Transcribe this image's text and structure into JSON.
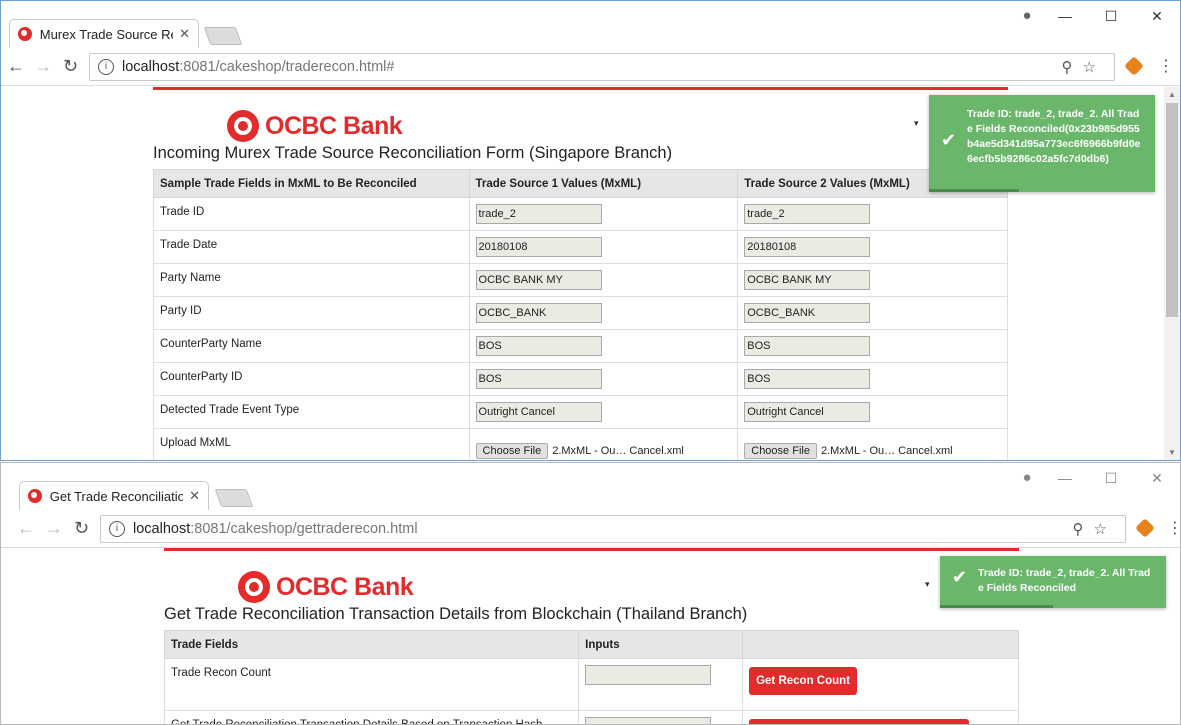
{
  "window1": {
    "tab_title": "Murex Trade Source Reconciliation",
    "tab_close": "✕",
    "address_host": "localhost",
    "address_path": ":8081/cakeshop/traderecon.html#",
    "bank_name": "OCBC Bank",
    "page_title": "Incoming Murex Trade Source Reconciliation Form (Singapore Branch)",
    "table": {
      "headers": [
        "Sample Trade Fields in MxML to Be Reconciled",
        "Trade Source 1 Values (MxML)",
        "Trade Source 2 Values (MxML)"
      ],
      "rows": [
        {
          "label": "Trade ID",
          "v1": "trade_2",
          "v2": "trade_2"
        },
        {
          "label": "Trade Date",
          "v1": "20180108",
          "v2": "20180108"
        },
        {
          "label": "Party Name",
          "v1": "OCBC BANK MY",
          "v2": "OCBC BANK MY"
        },
        {
          "label": "Party ID",
          "v1": "OCBC_BANK",
          "v2": "OCBC_BANK"
        },
        {
          "label": "CounterParty Name",
          "v1": "BOS",
          "v2": "BOS"
        },
        {
          "label": "CounterParty ID",
          "v1": "BOS",
          "v2": "BOS"
        },
        {
          "label": "Detected Trade Event Type",
          "v1": "Outright Cancel",
          "v2": "Outright Cancel"
        }
      ],
      "upload_label": "Upload MxML",
      "choose_file": "Choose File",
      "file1": "2.MxML - Ou… Cancel.xml",
      "file2": "2.MxML - Ou… Cancel.xml"
    },
    "toast": "Trade ID: trade_2, trade_2. All Trade Fields Reconciled(0x23b985d955b4ae5d341d95a773ec6f6966b9fd0e6ecfb5b9286c02a5fc7d0db6)",
    "toast_progress": 0.4
  },
  "window2": {
    "tab_title": "Get Trade Reconciliation",
    "tab_close": "✕",
    "address_host": "localhost",
    "address_path": ":8081/cakeshop/gettraderecon.html",
    "bank_name": "OCBC Bank",
    "page_title": "Get Trade Reconciliation Transaction Details from Blockchain (Thailand Branch)",
    "table": {
      "headers": [
        "Trade Fields",
        "Inputs",
        ""
      ],
      "row1_label": "Trade Recon Count",
      "row1_button": "Get Recon Count",
      "row2_label": "Get Trade Reconciliation Transaction Details Based on Transaction Hash"
    },
    "toast": "Trade ID: trade_2, trade_2. All Trade Fields Reconciled",
    "toast_progress": 0.5
  },
  "icons": {
    "back": "←",
    "forward": "→",
    "reload": "↻",
    "info": "i",
    "zoom": "⚲",
    "star": "☆",
    "account": "●",
    "minimize": "—",
    "maximize": "☐",
    "close": "✕",
    "menu": "⋮",
    "dropdown": "▾",
    "check": "✔"
  },
  "colors": {
    "brand_red": "#e32b2b",
    "toast_green": "#6ab76b",
    "field_bg": "#ebebe4"
  }
}
